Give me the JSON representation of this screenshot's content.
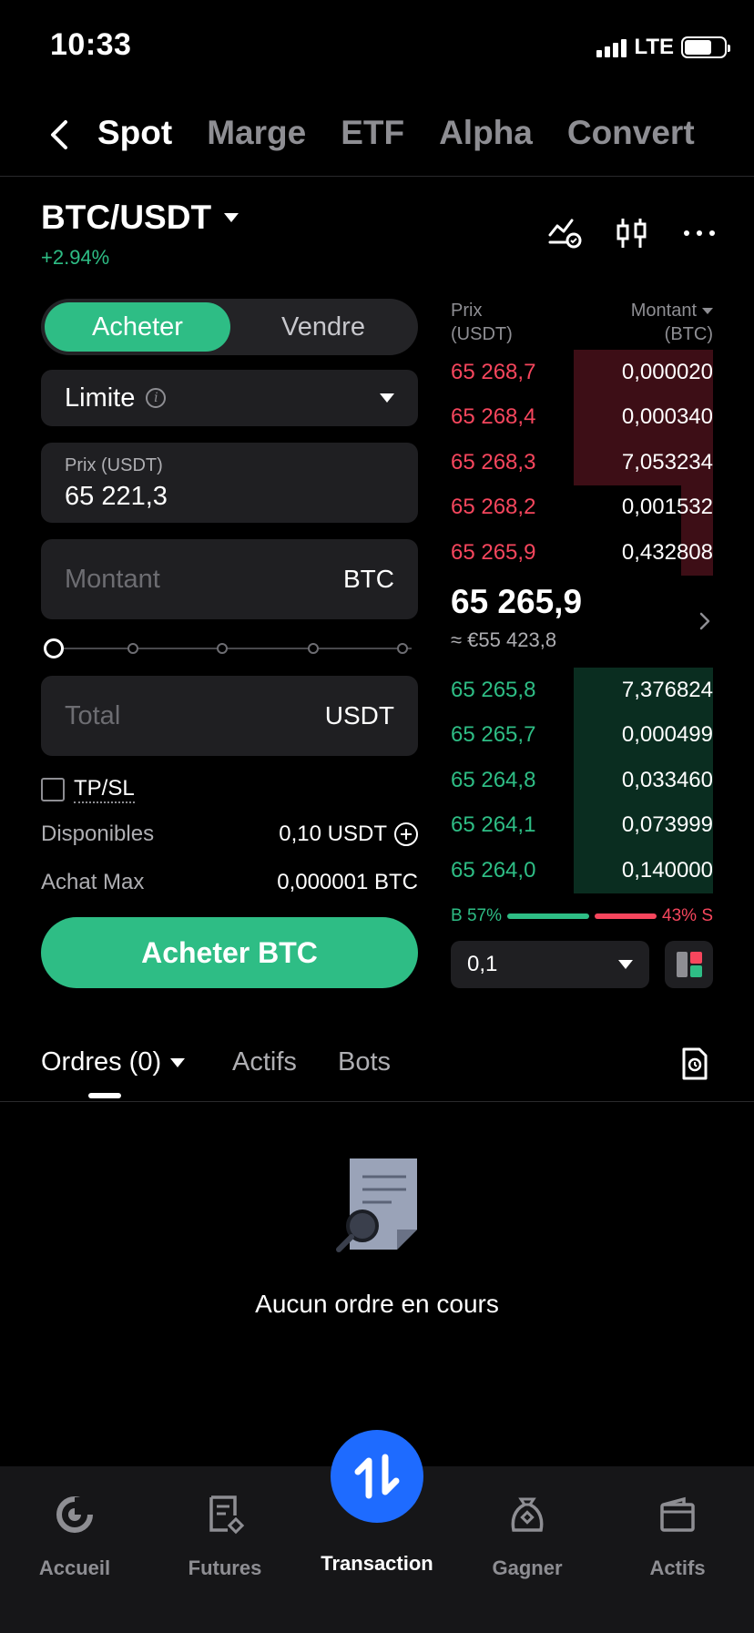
{
  "status": {
    "time": "10:33",
    "network": "LTE"
  },
  "nav": {
    "tabs": [
      "Spot",
      "Marge",
      "ETF",
      "Alpha",
      "Convert"
    ]
  },
  "pair": {
    "symbol": "BTC/USDT",
    "change": "+2.94%"
  },
  "form": {
    "buy_label": "Acheter",
    "sell_label": "Vendre",
    "order_type": "Limite",
    "price_label": "Prix (USDT)",
    "price_value": "65 221,3",
    "amount_placeholder": "Montant",
    "amount_unit": "BTC",
    "total_placeholder": "Total",
    "total_unit": "USDT",
    "slider_percent": 0,
    "tpsl_label": "TP/SL",
    "available_label": "Disponibles",
    "available_value": "0,10 USDT",
    "max_label": "Achat Max",
    "max_value": "0,000001 BTC",
    "submit_label": "Acheter BTC"
  },
  "orderbook": {
    "price_header_1": "Prix",
    "price_header_2": "(USDT)",
    "amount_header_1": "Montant",
    "amount_header_2": "(BTC)",
    "asks": [
      {
        "price": "65 268,7",
        "amount": "0,000020",
        "depth": 0.53
      },
      {
        "price": "65 268,4",
        "amount": "0,000340",
        "depth": 0.53
      },
      {
        "price": "65 268,3",
        "amount": "7,053234",
        "depth": 0.53
      },
      {
        "price": "65 268,2",
        "amount": "0,001532",
        "depth": 0.12
      },
      {
        "price": "65 265,9",
        "amount": "0,432808",
        "depth": 0.12
      }
    ],
    "mid_price": "65 265,9",
    "mid_fiat": "≈ €55 423,8",
    "bids": [
      {
        "price": "65 265,8",
        "amount": "7,376824",
        "depth": 0.53
      },
      {
        "price": "65 265,7",
        "amount": "0,000499",
        "depth": 0.53
      },
      {
        "price": "65 264,8",
        "amount": "0,033460",
        "depth": 0.53
      },
      {
        "price": "65 264,1",
        "amount": "0,073999",
        "depth": 0.53
      },
      {
        "price": "65 264,0",
        "amount": "0,140000",
        "depth": 0.53
      }
    ],
    "buy_ratio": "B 57%",
    "sell_ratio": "43% S",
    "precision": "0,1"
  },
  "orders": {
    "tab_orders": "Ordres (0)",
    "tab_assets": "Actifs",
    "tab_bots": "Bots",
    "empty_text": "Aucun ordre en cours"
  },
  "bottom_nav": {
    "home": "Accueil",
    "futures": "Futures",
    "transaction": "Transaction",
    "earn": "Gagner",
    "assets": "Actifs"
  },
  "colors": {
    "buy": "#2ebd85",
    "sell": "#f6465d",
    "fab": "#1e6bff"
  }
}
